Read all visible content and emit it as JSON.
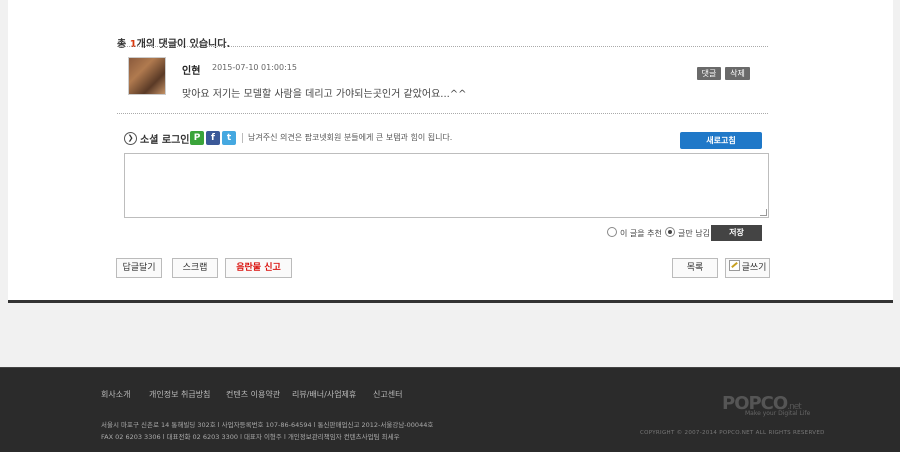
{
  "comments_header": {
    "prefix": "총 ",
    "count": "1",
    "suffix": "개의 댓글이 있습니다."
  },
  "comment": {
    "author": "인현",
    "date": "2015-07-10 01:00:15",
    "text": "맞아요 저기는 모델할 사람을 데리고 가야되는곳인거 같았어요...^^",
    "reply_label": "댓글",
    "delete_label": "삭제"
  },
  "social": {
    "label": "소셜 로그인",
    "icons": [
      "P",
      "f",
      "t"
    ],
    "note": "남겨주신 의견은 팝코넷회원 분들에게 큰 보탬과 힘이 됩니다.",
    "refresh_label": "새로고침"
  },
  "comment_form": {
    "recommend_label": "이 글을 추천",
    "comment_only_label": "글만 남김",
    "save_label": "저장"
  },
  "actions": {
    "reply": "답글달기",
    "scrap": "스크랩",
    "report": "음란물 신고",
    "list": "목록",
    "write": "글쓰기"
  },
  "footer": {
    "nav": [
      "회사소개",
      "개인정보 취급방침",
      "컨텐츠 이용약관",
      "리뷰/배너/사업제휴",
      "신고센터"
    ],
    "info_line1": "서울시 마포구 신촌로 14 통해빌딩 302호    l    사업자등록번호 107-86-64594    l    통신판매업신고 2012-서울강남-00044호",
    "info_line2": "FAX 02 6203 3306    l    대표전화 02 6203 3300    l    대표자 이형주    l    개인정보관리책임자 컨텐츠사업팀 최세우",
    "logo_text": "POPCO",
    "logo_suffix": ".net",
    "logo_tagline": "Make your Digital Life",
    "copyright": "COPYRIGHT © 2007-2014 POPCO.NET ALL RIGHTS RESERVED"
  },
  "colors": {
    "accent_blue": "#1f78c8",
    "count_red": "#d9370c",
    "report_red": "#d9100c",
    "footer_bg": "#2b2b2b"
  }
}
